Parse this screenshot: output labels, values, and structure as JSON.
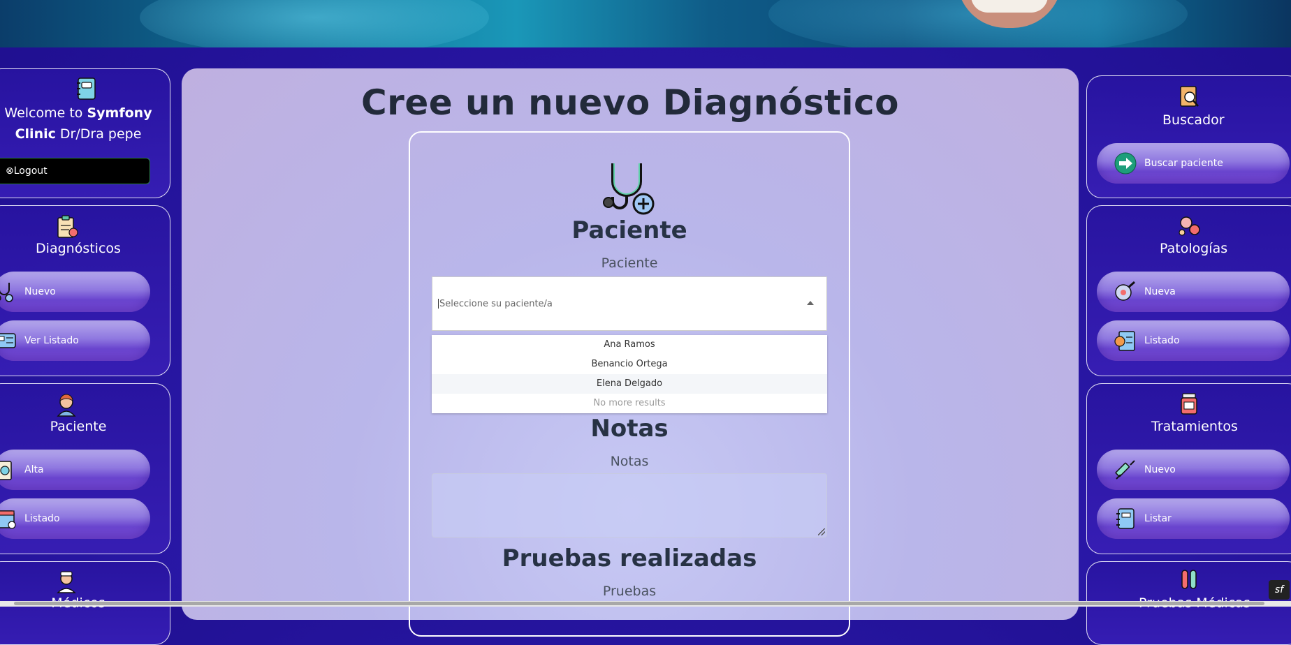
{
  "left_sidebar": {
    "welcome_prefix": "Welcome to ",
    "welcome_brand": "Symfony Clinic",
    "welcome_suffix": " Dr/Dra pepe",
    "logout_label": "⊗Logout",
    "diagnosticos": {
      "title": "Diagnósticos",
      "nuevo": "Nuevo",
      "ver_listado": "Ver Listado"
    },
    "paciente": {
      "title": "Paciente",
      "alta": "Alta",
      "listado": "Listado"
    },
    "medicos": {
      "title": "Médicos"
    }
  },
  "right_sidebar": {
    "buscador": {
      "title": "Buscador",
      "buscar": "Buscar paciente"
    },
    "patologias": {
      "title": "Patologías",
      "nueva": "Nueva",
      "listado": "Listado"
    },
    "tratamientos": {
      "title": "Tratamientos",
      "nuevo": "Nuevo",
      "listar": "Listar"
    },
    "pruebas": {
      "title": "Pruebas Médicas"
    }
  },
  "main": {
    "title": "Cree un nuevo Diagnóstico",
    "paciente_heading": "Paciente",
    "paciente_label": "Paciente",
    "paciente_placeholder": "Seleccione su paciente/a",
    "dropdown_options": [
      "Ana Ramos",
      "Benancio Ortega",
      "Elena Delgado"
    ],
    "dropdown_no_more": "No more results",
    "notas_heading": "Notas",
    "notas_label": "Notas",
    "pruebas_heading": "Pruebas realizadas",
    "pruebas_label": "Pruebas"
  },
  "colors": {
    "page_bg": "#2a18a8",
    "main_panel": "#bdb8ea",
    "pill_accent": "#7a4bd6",
    "logout_bg": "#000000"
  }
}
